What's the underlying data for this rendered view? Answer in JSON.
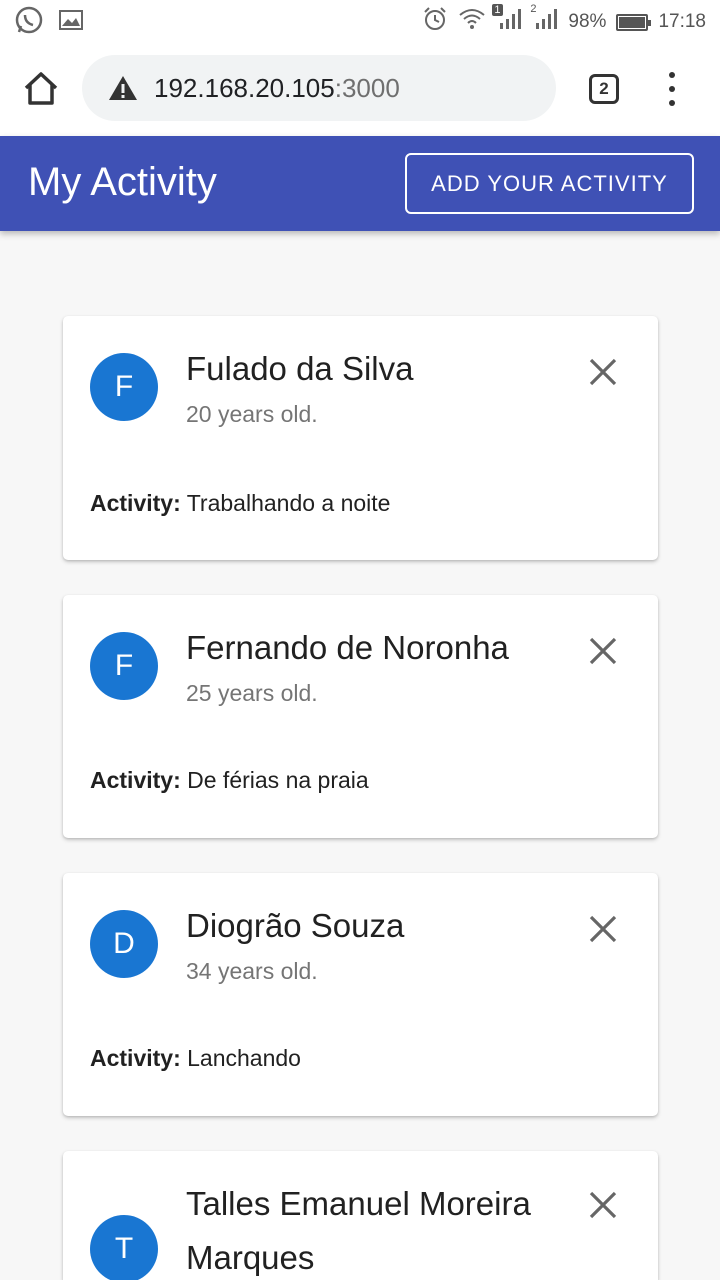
{
  "statusbar": {
    "battery": "98%",
    "time": "17:18",
    "sim1": "1",
    "sim2": "2"
  },
  "browser": {
    "url_host": "192.168.20.105",
    "url_port": ":3000",
    "tab_count": "2"
  },
  "appbar": {
    "title": "My Activity",
    "add_button": "ADD YOUR ACTIVITY"
  },
  "activity_label": "Activity:",
  "cards": [
    {
      "initial": "F",
      "name": "Fulado da Silva",
      "age": "20 years old.",
      "activity": "Trabalhando a noite"
    },
    {
      "initial": "F",
      "name": "Fernando de Noronha",
      "age": "25 years old.",
      "activity": "De férias na praia"
    },
    {
      "initial": "D",
      "name": "Diogrão Souza",
      "age": "34 years old.",
      "activity": "Lanchando"
    },
    {
      "initial": "T",
      "name": "Talles Emanuel Moreira Marques",
      "age": "",
      "activity": ""
    }
  ],
  "colors": {
    "appbar": "#3f51b5",
    "avatar": "#1976d2",
    "background": "#f7f7f7"
  }
}
